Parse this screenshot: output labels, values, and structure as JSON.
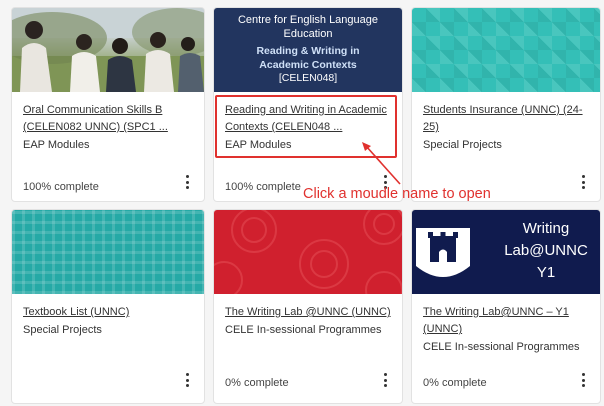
{
  "courses": [
    {
      "title": "Oral Communication Skills B (CELEN082 UNNC) (SPC1 ...",
      "category": "EAP Modules",
      "progress": "100% complete",
      "progress_value": 100,
      "banner": "photo"
    },
    {
      "title": "Reading and Writing in Academic Contexts (CELEN048 ...",
      "category": "EAP Modules",
      "progress": "100% complete",
      "progress_value": 100,
      "banner": "navy",
      "banner_text": {
        "line1": "Centre for English Language",
        "line2": "Education",
        "line3": "Reading & Writing in",
        "line4": "Academic Contexts",
        "line5": "[CELEN048]"
      }
    },
    {
      "title": "Students Insurance (UNNC) (24-25)",
      "category": "Special Projects",
      "progress": "",
      "banner": "teal"
    },
    {
      "title": "Textbook List (UNNC)",
      "category": "Special Projects",
      "progress": "",
      "banner": "plaid"
    },
    {
      "title": "The Writing Lab @UNNC (UNNC)",
      "category": "CELE In-sessional Programmes",
      "progress": "0% complete",
      "progress_value": 0,
      "banner": "red"
    },
    {
      "title": "The Writing Lab@UNNC – Y1 (UNNC)",
      "category": "CELE In-sessional Programmes",
      "progress": "0% complete",
      "progress_value": 0,
      "banner": "writing",
      "banner_text": {
        "line1": "Writing",
        "line2": "Lab@UNNC",
        "line3": "Y1"
      }
    }
  ],
  "annotation": {
    "text": "Click a moudle name to open",
    "color": "#e0312e"
  },
  "colors": {
    "navy": "#22355f",
    "teal": "#34bfb7",
    "plaid": "#25a9a6",
    "red": "#d0202e",
    "dark_navy": "#101b4e"
  }
}
